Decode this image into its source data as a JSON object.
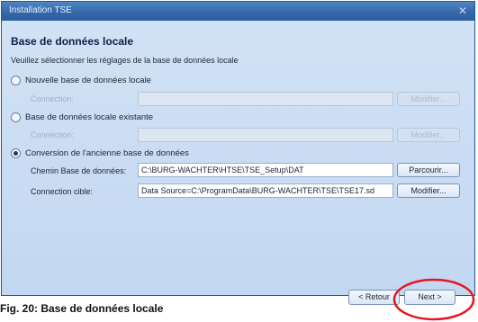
{
  "window": {
    "title": "Installation TSE",
    "close_glyph": "✕"
  },
  "heading": "Base de données locale",
  "subtitle": "Veuillez sélectionner les réglages de la base de données locale",
  "options": [
    {
      "label": "Nouvelle base de données locale",
      "selected": false,
      "field_label": "Connection:",
      "field_value": "",
      "button_label": "Modifier..."
    },
    {
      "label": "Base de données locale existante",
      "selected": false,
      "field_label": "Connection:",
      "field_value": "",
      "button_label": "Modifier..."
    },
    {
      "label": "Conversion de l'ancienne base de données",
      "selected": true,
      "db_path_label": "Chemin Base de données:",
      "db_path_value": "C:\\BURG-WACHTER\\HTSE\\TSE_Setup\\DAT",
      "browse_label": "Parcourir...",
      "target_label": "Connection cible:",
      "target_value": "Data Source=C:\\ProgramData\\BURG-WACHTER\\TSE\\TSE17.sd",
      "modify_label": "Modifier..."
    }
  ],
  "footer": {
    "back_label": "< Retour",
    "next_label": "Next >"
  },
  "caption": "Fig. 20: Base de données locale",
  "colors": {
    "window_bg": "#c9dcf3",
    "titlebar": "#3a6eb0",
    "highlight": "#e8141e"
  }
}
